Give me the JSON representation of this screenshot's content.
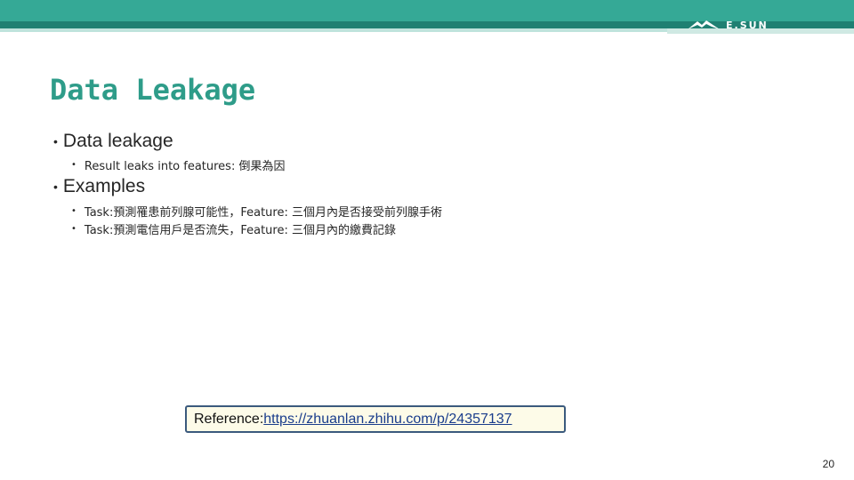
{
  "header": {
    "brand": "E.SUN",
    "logo_icon": "mountain-logo-icon"
  },
  "slide": {
    "title": "Data Leakage",
    "sections": [
      {
        "heading": "Data leakage",
        "items": [
          "Result leaks into features: 倒果為因"
        ]
      },
      {
        "heading": "Examples",
        "items": [
          "Task:預測罹患前列腺可能性，Feature: 三個月內是否接受前列腺手術",
          "Task:預測電信用戶是否流失，Feature: 三個月內的繳費記錄"
        ]
      }
    ],
    "reference_label": "Reference: ",
    "reference_url": "https://zhuanlan.zhihu.com/p/24357137",
    "page_number": "20"
  },
  "colors": {
    "header_teal": "#35a996",
    "title_teal": "#2e9c89",
    "reference_border": "#3b5a7d",
    "reference_bg": "#fdfbe8"
  }
}
